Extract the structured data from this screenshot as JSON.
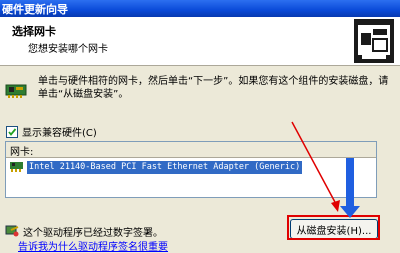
{
  "window": {
    "title": "硬件更新向导"
  },
  "header": {
    "title": "选择网卡",
    "subtitle": "您想安装哪个网卡"
  },
  "instructions": "单击与硬件相符的网卡，然后单击“下一步”。如果您有这个组件的安装磁盘，请单击“从磁盘安装”。",
  "compat_checkbox": {
    "label": "显示兼容硬件(C)",
    "checked": true
  },
  "adapter_list": {
    "header": "网卡:",
    "items": [
      "Intel 21140-Based PCI Fast Ethernet Adapter (Generic)"
    ]
  },
  "signature": {
    "text": "这个驱动程序已经过数字签署。",
    "link": "告诉我为什么驱动程序签名很重要"
  },
  "buttons": {
    "have_disk": "从磁盘安装(H)..."
  },
  "colors": {
    "title_bar": "#0a4ad8",
    "selection": "#316ac5",
    "annotation_red": "#e00000",
    "annotation_blue": "#1f5fe0"
  }
}
